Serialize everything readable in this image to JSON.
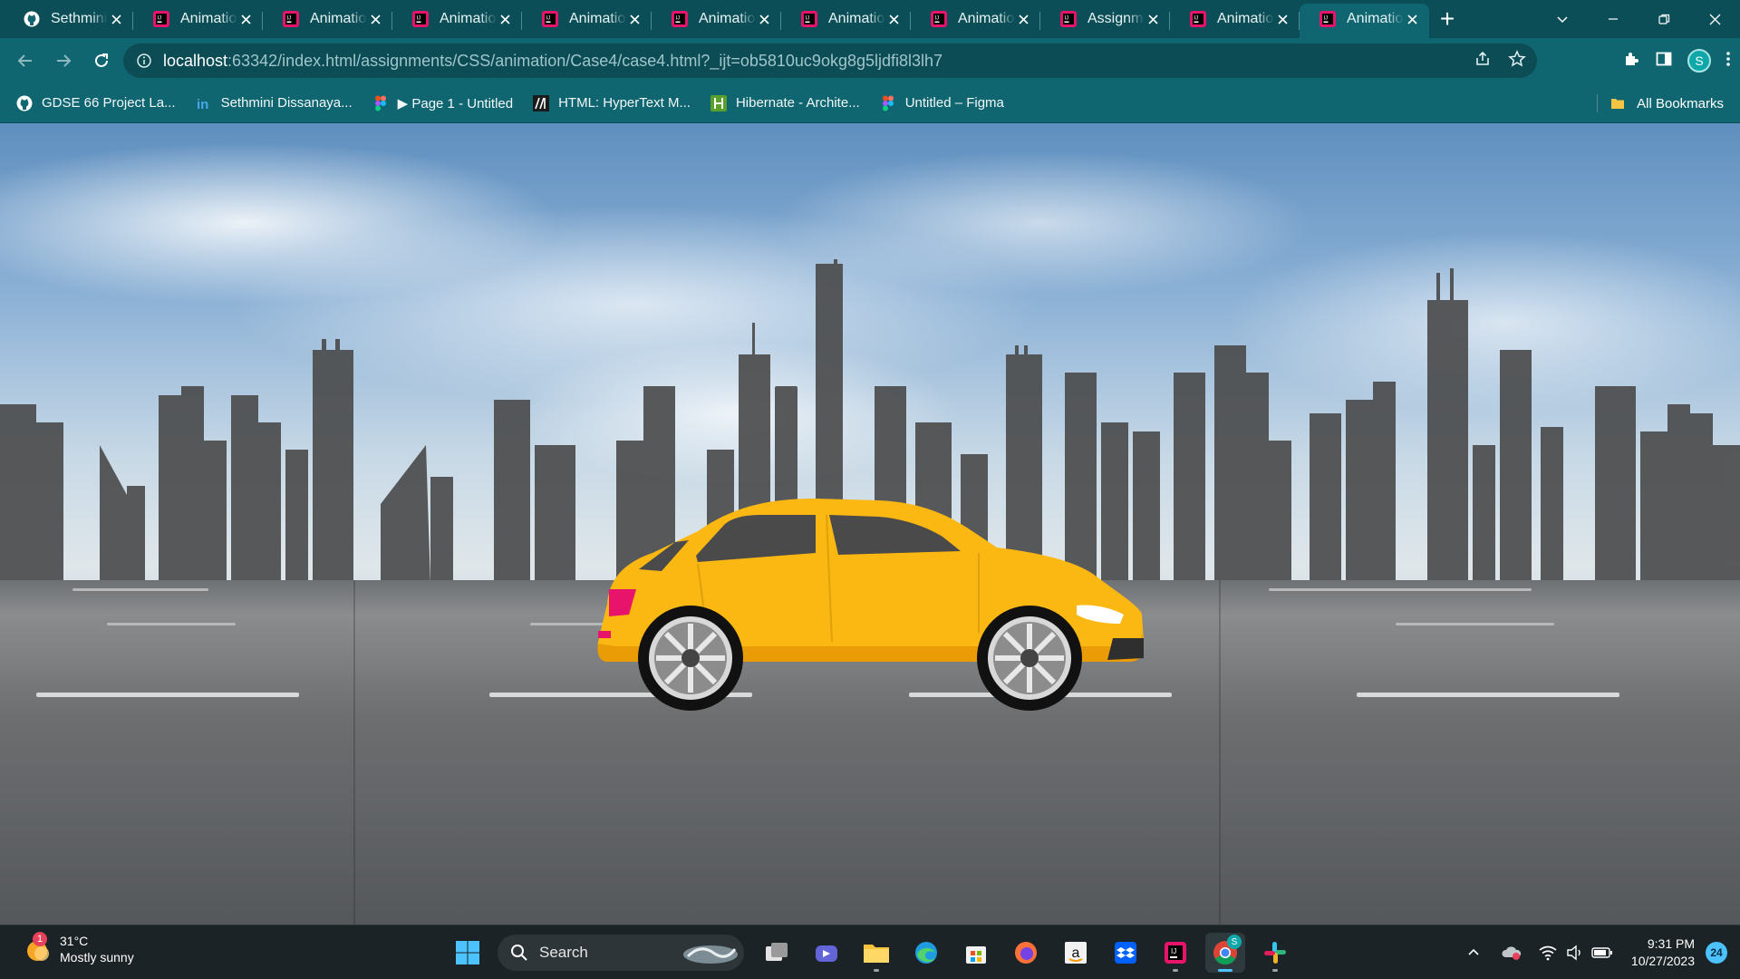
{
  "browser": {
    "tabs": [
      {
        "title": "Sethmini",
        "icon": "github-icon",
        "active": false
      },
      {
        "title": "Animatio",
        "icon": "jetbrains-icon",
        "active": false
      },
      {
        "title": "Animatio",
        "icon": "jetbrains-icon",
        "active": false
      },
      {
        "title": "Animatio",
        "icon": "jetbrains-icon",
        "active": false
      },
      {
        "title": "Animatio",
        "icon": "jetbrains-icon",
        "active": false
      },
      {
        "title": "Animatio",
        "icon": "jetbrains-icon",
        "active": false
      },
      {
        "title": "Animatio",
        "icon": "jetbrains-icon",
        "active": false
      },
      {
        "title": "Animatio",
        "icon": "jetbrains-icon",
        "active": false
      },
      {
        "title": "Assignm",
        "icon": "jetbrains-icon",
        "active": false
      },
      {
        "title": "Animatio",
        "icon": "jetbrains-icon",
        "active": false
      },
      {
        "title": "Animatio",
        "icon": "jetbrains-icon",
        "active": true
      }
    ],
    "url_host": "localhost",
    "url_rest": ":63342/index.html/assignments/CSS/animation/Case4/case4.html?_ijt=ob5810uc9okg8g5ljdfi8l3lh7",
    "profile_initial": "S",
    "bookmarks": [
      {
        "label": "GDSE 66 Project La...",
        "icon": "github-icon"
      },
      {
        "label": "Sethmini Dissanaya...",
        "icon": "linkedin-icon"
      },
      {
        "label": "▶ Page 1 - Untitled",
        "icon": "figma-icon"
      },
      {
        "label": "HTML: HyperText M...",
        "icon": "mdn-icon"
      },
      {
        "label": "Hibernate - Archite...",
        "icon": "hibernate-icon"
      },
      {
        "label": "Untitled – Figma",
        "icon": "figma-icon"
      }
    ],
    "all_bookmarks": "All Bookmarks"
  },
  "taskbar": {
    "weather_temp": "31°C",
    "weather_desc": "Mostly sunny",
    "weather_badge": "1",
    "search_label": "Search",
    "time": "9:31 PM",
    "date": "10/27/2023",
    "notifications": "24",
    "chrome_badge": "S"
  },
  "colors": {
    "tab_strip": "#0b4e57",
    "toolbar": "#0f6570",
    "car_body": "#fbb712",
    "taskbar": "#1c2326"
  }
}
